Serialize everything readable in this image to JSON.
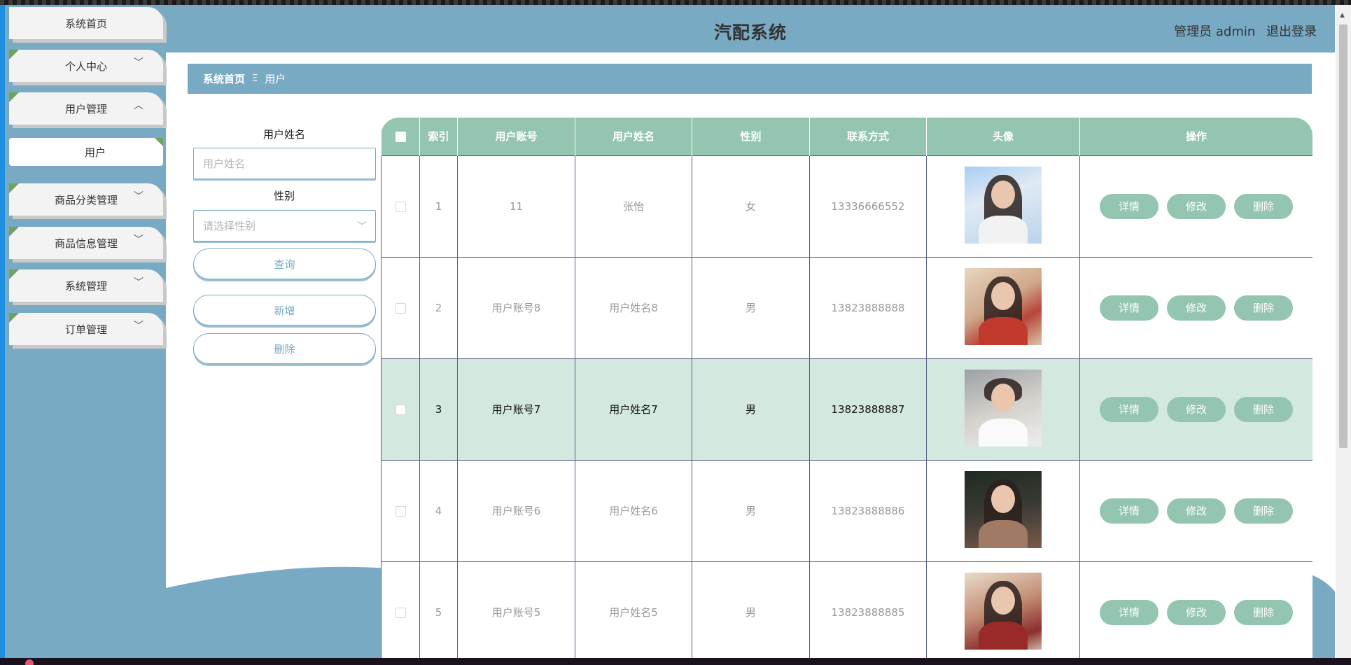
{
  "app": {
    "title": "汽配系统",
    "user_role": "管理员 admin",
    "logout_label": "退出登录"
  },
  "sidebar": {
    "items": [
      {
        "label": "系统首页",
        "expandable": false
      },
      {
        "label": "个人中心",
        "expandable": true,
        "expanded": false
      },
      {
        "label": "用户管理",
        "expandable": true,
        "expanded": true
      },
      {
        "label": "商品分类管理",
        "expandable": true,
        "expanded": false
      },
      {
        "label": "商品信息管理",
        "expandable": true,
        "expanded": false
      },
      {
        "label": "系统管理",
        "expandable": true,
        "expanded": false
      },
      {
        "label": "订单管理",
        "expandable": true,
        "expanded": false
      }
    ],
    "subitems": [
      {
        "label": "用户"
      }
    ],
    "chevron_down": "﹀",
    "chevron_up": "︿"
  },
  "breadcrumb": {
    "home": "系统首页",
    "separator": "Ξ",
    "current": "用户"
  },
  "filters": {
    "name_label": "用户姓名",
    "name_placeholder": "用户姓名",
    "gender_label": "性别",
    "gender_placeholder": "请选择性别",
    "query_button": "查询",
    "add_button": "新增",
    "delete_button": "删除"
  },
  "table": {
    "columns": [
      "索引",
      "用户账号",
      "用户姓名",
      "性别",
      "联系方式",
      "头像",
      "操作"
    ],
    "rows": [
      {
        "index": "1",
        "account": "11",
        "name": "张怡",
        "gender": "女",
        "phone": "13336666552",
        "selected": false
      },
      {
        "index": "2",
        "account": "用户账号8",
        "name": "用户姓名8",
        "gender": "男",
        "phone": "13823888888",
        "selected": false
      },
      {
        "index": "3",
        "account": "用户账号7",
        "name": "用户姓名7",
        "gender": "男",
        "phone": "13823888887",
        "selected": true
      },
      {
        "index": "4",
        "account": "用户账号6",
        "name": "用户姓名6",
        "gender": "男",
        "phone": "13823888886",
        "selected": false
      },
      {
        "index": "5",
        "account": "用户账号5",
        "name": "用户姓名5",
        "gender": "男",
        "phone": "13823888885",
        "selected": false
      }
    ],
    "actions": {
      "detail": "详情",
      "edit": "修改",
      "delete": "删除"
    }
  },
  "colors": {
    "primary": "#79aac4",
    "accent": "#93c5b0",
    "row_selected": "#d3e8df",
    "menu_corner": "#6ea35f"
  }
}
